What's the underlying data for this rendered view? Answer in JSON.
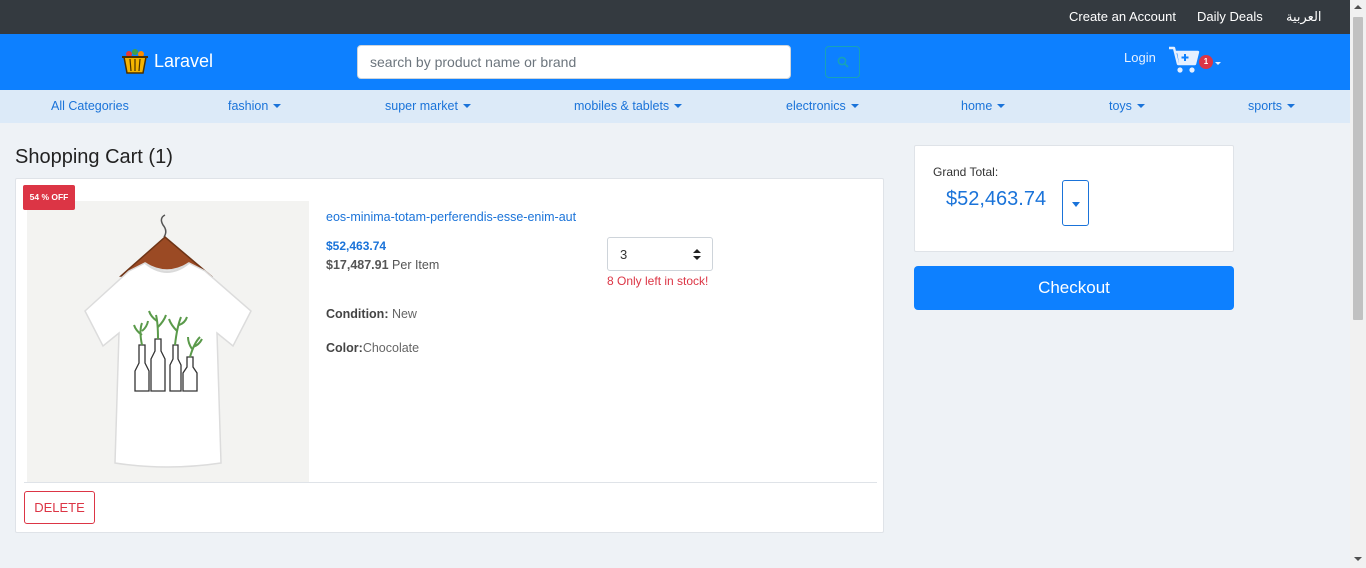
{
  "topbar": {
    "create_account": "Create an Account",
    "daily_deals": "Daily Deals",
    "language": "العربية"
  },
  "header": {
    "logo_text": "Laravel",
    "search_placeholder": "search by product name or brand",
    "login": "Login",
    "cart_count": "1"
  },
  "categories": [
    "All Categories",
    "fashion",
    "super market",
    "mobiles & tablets",
    "electronics",
    "home",
    "toys",
    "sports"
  ],
  "cart": {
    "title": "Shopping Cart (1)",
    "item": {
      "discount_badge": "54 % OFF",
      "name": "eos-minima-totam-perferendis-esse-enim-aut",
      "line_total": "$52,463.74",
      "unit_price": "$17,487.91",
      "per_item_suffix": " Per Item",
      "condition_label": "Condition:",
      "condition_value": " New",
      "color_label": "Color:",
      "color_value": "Chocolate",
      "quantity": "3",
      "stock_note": "8 Only left in stock!"
    },
    "delete_label": "DELETE"
  },
  "summary": {
    "grand_total_label": "Grand Total:",
    "grand_total_value": "$52,463.74",
    "checkout_label": "Checkout"
  },
  "colors": {
    "primary": "#0d80ff",
    "topbar": "#343a40",
    "danger": "#dc3545",
    "category_bar": "#dceaf8",
    "page_bg": "#eef2f6"
  }
}
